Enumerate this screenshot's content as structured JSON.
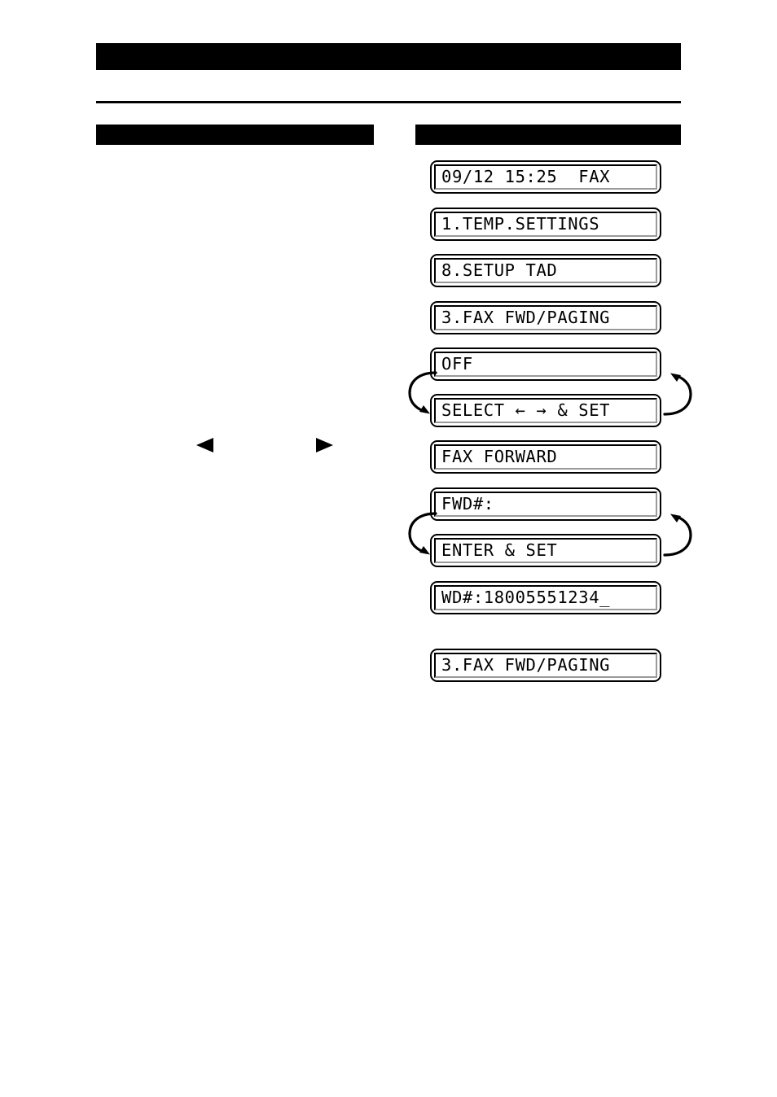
{
  "document": {
    "title_bar": "",
    "section_left_heading": "",
    "section_right_heading": ""
  },
  "left_column": {
    "nav_left_icon": "triangle-left",
    "nav_right_icon": "triangle-right"
  },
  "lcd_sequence": {
    "steps": [
      {
        "id": "standby",
        "text": "09/12 15:25  FAX",
        "name": "lcd-standby-display"
      },
      {
        "id": "menu1",
        "text": "1.TEMP.SETTINGS",
        "name": "lcd-menu-temp-settings"
      },
      {
        "id": "menu8",
        "text": "8.SETUP TAD",
        "name": "lcd-menu-setup-tad"
      },
      {
        "id": "menu3",
        "text": "3.FAX FWD/PAGING",
        "name": "lcd-menu-fax-fwd-paging"
      },
      {
        "id": "off",
        "text": "OFF",
        "name": "lcd-option-off"
      },
      {
        "id": "select-set",
        "text": "SELECT ← → & SET",
        "name": "lcd-prompt-select-set"
      },
      {
        "id": "fax-forward",
        "text": "FAX FORWARD",
        "name": "lcd-option-fax-forward"
      },
      {
        "id": "fwd-num",
        "text": "FWD#:",
        "name": "lcd-prompt-fwd-number"
      },
      {
        "id": "enter-set",
        "text": "ENTER & SET",
        "name": "lcd-prompt-enter-set"
      },
      {
        "id": "fwd-entered",
        "text": "WD#:18005551234_",
        "name": "lcd-fwd-number-entered"
      },
      {
        "id": "menu3-return",
        "text": "3.FAX FWD/PAGING",
        "name": "lcd-menu-fax-fwd-paging-return"
      }
    ]
  },
  "arrows": {
    "loop_upper_left": "curved-loop-arrow-left",
    "loop_upper_right": "curved-loop-arrow-right",
    "loop_lower_left": "curved-loop-arrow-left",
    "loop_lower_right": "curved-loop-arrow-right"
  },
  "colors": {
    "ink": "#000000",
    "paper": "#ffffff",
    "lcd_shadow": "#9a9a9a"
  }
}
